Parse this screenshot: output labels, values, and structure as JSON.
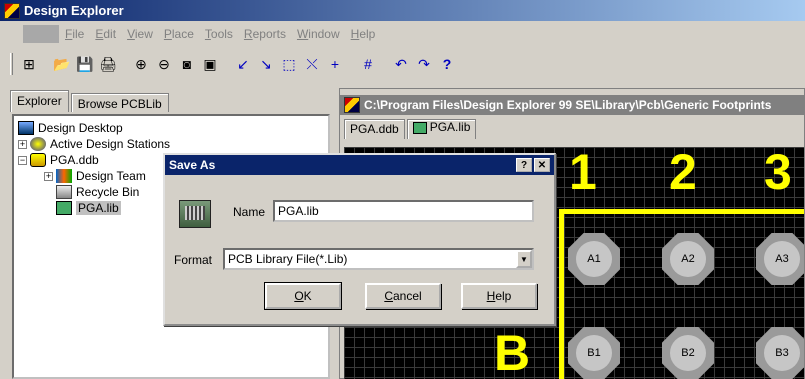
{
  "app": {
    "title": "Design Explorer"
  },
  "menu": {
    "items": [
      {
        "key": "F",
        "rest": "ile"
      },
      {
        "key": "E",
        "rest": "dit"
      },
      {
        "key": "V",
        "rest": "iew"
      },
      {
        "key": "P",
        "rest": "lace"
      },
      {
        "key": "T",
        "rest": "ools"
      },
      {
        "key": "R",
        "rest": "eports"
      },
      {
        "key": "W",
        "rest": "indow"
      },
      {
        "key": "H",
        "rest": "elp"
      }
    ]
  },
  "toolbar": {
    "icons": [
      "project-tree-icon",
      "open-folder-icon",
      "save-icon",
      "print-icon",
      "zoom-in-icon",
      "zoom-out-icon",
      "zoom-fit-icon",
      "zoom-area-icon",
      "interactive-route-icon",
      "line-icon",
      "select-icon",
      "deselect-icon",
      "move-icon",
      "grid-icon",
      "undo-icon",
      "redo-icon",
      "help-icon"
    ],
    "glyphs": [
      "⊞",
      "📂",
      "💾",
      "🖨",
      "⊕",
      "⊖",
      "◙",
      "▣",
      "↙",
      "↘",
      "⬚",
      "⤬",
      "+",
      "#",
      "↶",
      "↷",
      "?"
    ]
  },
  "explorer": {
    "tabs": [
      "Explorer",
      "Browse PCBLib"
    ],
    "tree": [
      {
        "label": "Design Desktop",
        "indent": 0,
        "pm": ""
      },
      {
        "label": "Active Design Stations",
        "indent": 1,
        "pm": "+"
      },
      {
        "label": "PGA.ddb",
        "indent": 1,
        "pm": "−"
      },
      {
        "label": "Design Team",
        "indent": 2,
        "pm": "+"
      },
      {
        "label": "Recycle Bin",
        "indent": 2,
        "pm": ""
      },
      {
        "label": "PGA.lib",
        "indent": 2,
        "pm": "",
        "selected": true
      }
    ]
  },
  "document": {
    "title": "C:\\Program Files\\Design Explorer 99 SE\\Library\\Pcb\\Generic Footprints",
    "tabs": [
      "PGA.ddb",
      "PGA.lib"
    ],
    "pcb": {
      "column_labels": [
        "1",
        "2",
        "3"
      ],
      "row_label": "B",
      "pads": [
        "A1",
        "A2",
        "A3",
        "B1",
        "B2",
        "B3"
      ]
    }
  },
  "dialog": {
    "title": "Save As",
    "help_btn": "?",
    "close_btn": "✕",
    "name_label": "Name",
    "name_value": "PGA.lib",
    "format_label": "Format",
    "format_value": "PCB Library File(*.Lib)",
    "ok": {
      "key": "O",
      "rest": "K"
    },
    "cancel": {
      "key": "C",
      "rest": "ancel"
    },
    "help": {
      "key": "H",
      "rest": "elp"
    }
  }
}
